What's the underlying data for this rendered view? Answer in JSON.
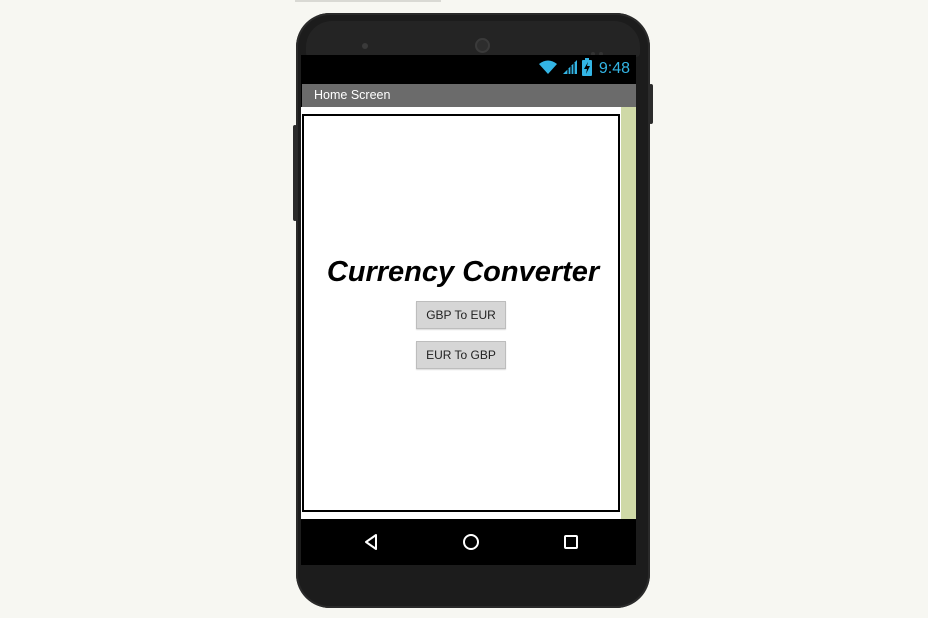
{
  "status_bar": {
    "time": "9:48",
    "icons": [
      "wifi-icon",
      "cell-signal-icon",
      "battery-charging-icon"
    ],
    "accent_color": "#33b5e5"
  },
  "app": {
    "screen_title": "Home Screen",
    "heading": "Currency Converter",
    "buttons": {
      "gbp_to_eur": "GBP To EUR",
      "eur_to_gbp": "EUR To GBP"
    }
  },
  "nav_bar": {
    "icons": [
      "back-icon",
      "home-icon",
      "recents-icon"
    ]
  },
  "colors": {
    "title_bar": "#6b6b6b",
    "scroll_strip": "#cfd9a7",
    "button_bg": "#d6d6d6"
  }
}
